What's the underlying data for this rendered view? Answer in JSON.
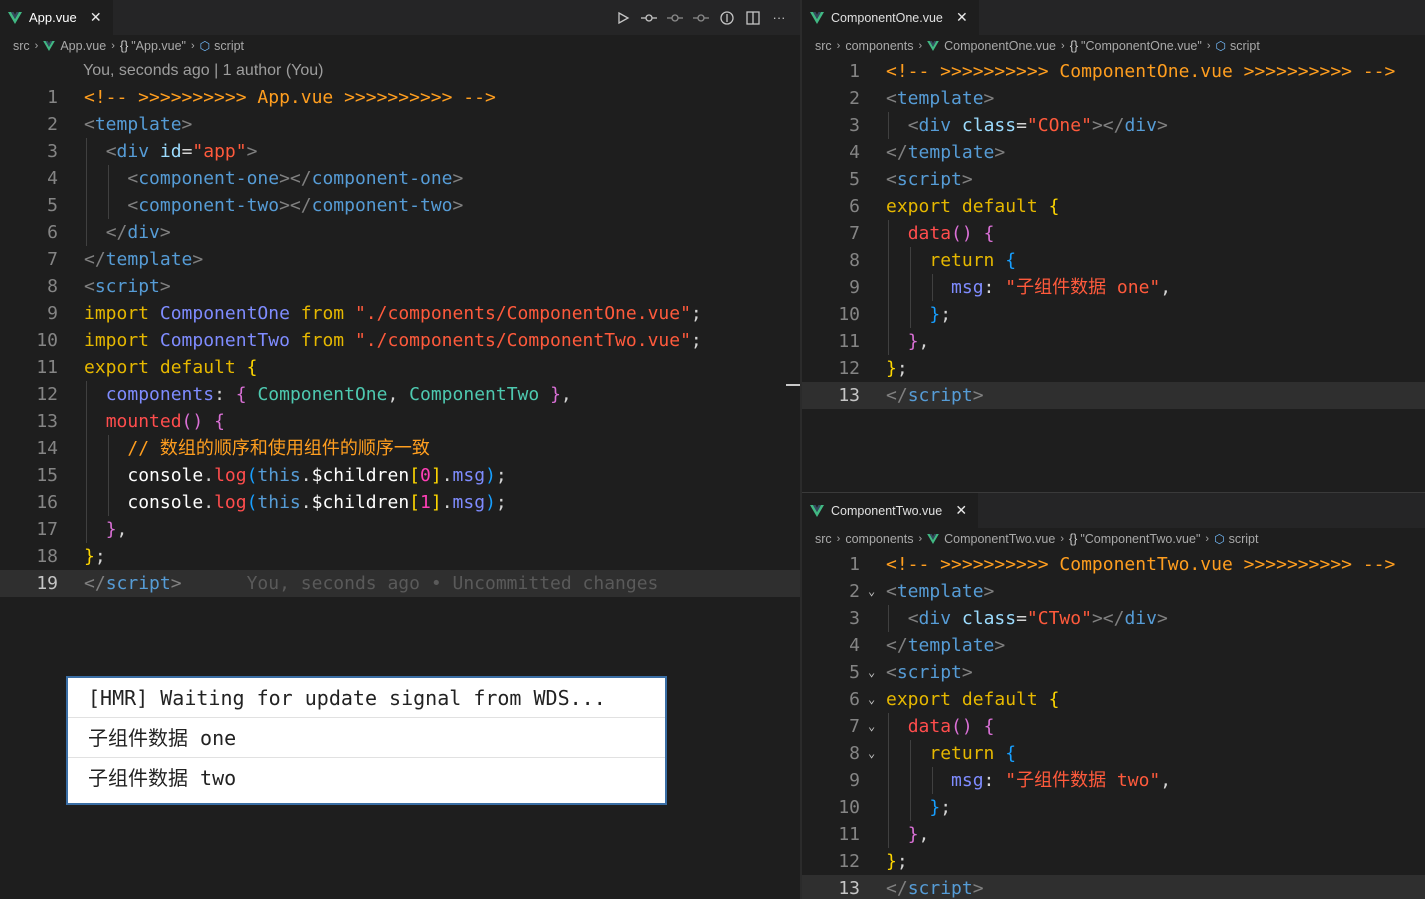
{
  "left": {
    "tab": {
      "label": "App.vue",
      "close": "✕"
    },
    "breadcrumb": [
      "src",
      "App.vue",
      "\"App.vue\"",
      "script"
    ],
    "codelens": "You, seconds ago | 1 author (You)",
    "blame": "You, seconds ago • Uncommitted changes",
    "line_numbers": [
      "1",
      "2",
      "3",
      "4",
      "5",
      "6",
      "7",
      "8",
      "9",
      "10",
      "11",
      "12",
      "13",
      "14",
      "15",
      "16",
      "17",
      "18",
      "19"
    ]
  },
  "right_top": {
    "tab": {
      "label": "ComponentOne.vue",
      "close": "✕"
    },
    "breadcrumb": [
      "src",
      "components",
      "ComponentOne.vue",
      "\"ComponentOne.vue\"",
      "script"
    ],
    "line_numbers": [
      "1",
      "2",
      "3",
      "4",
      "5",
      "6",
      "7",
      "8",
      "9",
      "10",
      "11",
      "12",
      "13"
    ]
  },
  "right_bottom": {
    "tab": {
      "label": "ComponentTwo.vue",
      "close": "✕"
    },
    "breadcrumb": [
      "src",
      "components",
      "ComponentTwo.vue",
      "\"ComponentTwo.vue\"",
      "script"
    ],
    "line_numbers": [
      "1",
      "2",
      "3",
      "4",
      "5",
      "6",
      "7",
      "8",
      "9",
      "10",
      "11",
      "12",
      "13"
    ]
  },
  "console": {
    "lines": [
      "[HMR] Waiting for update signal from WDS...",
      "子组件数据 one",
      "子组件数据 two"
    ]
  },
  "code_text": {
    "app_comment": "<!-- >>>>>>>>>> App.vue >>>>>>>>>> -->",
    "one_comment": "<!-- >>>>>>>>>> ComponentOne.vue >>>>>>>>>> -->",
    "two_comment": "<!-- >>>>>>>>>> ComponentTwo.vue >>>>>>>>>> -->",
    "cn_comment": "// 数组的顺序和使用组件的顺序一致",
    "msg_one": "\"子组件数据 one\"",
    "msg_two": "\"子组件数据 two\"",
    "import_one_path": "\"./components/ComponentOne.vue\"",
    "import_two_path": "\"./components/ComponentTwo.vue\""
  },
  "icons": {
    "actions": [
      "run-icon",
      "source-control-icon",
      "previous-change-icon",
      "next-change-icon",
      "open-changes-icon",
      "split-editor-icon",
      "more-icon"
    ]
  },
  "colors": {
    "background": "#1e1e1e",
    "vue_green": "#41b883",
    "comment_orange": "#ff9e1f"
  }
}
